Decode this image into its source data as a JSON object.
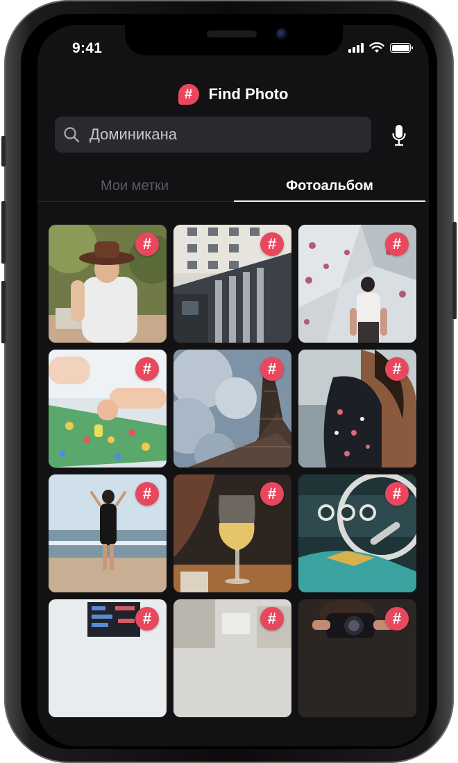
{
  "status_bar": {
    "time": "9:41",
    "icons": [
      "signal-icon",
      "wifi-icon",
      "battery-icon"
    ],
    "battery_level": 1.0
  },
  "header": {
    "logo_glyph": "#",
    "title": "Find Photo"
  },
  "search": {
    "value": "Доминикана",
    "icon": "search-icon",
    "mic_icon": "microphone-icon"
  },
  "tabs": [
    {
      "label": "Мои метки",
      "active": false
    },
    {
      "label": "Фотоальбом",
      "active": true
    }
  ],
  "photos": [
    {
      "subject": "man-in-hat",
      "badge": "#"
    },
    {
      "subject": "building",
      "badge": "#"
    },
    {
      "subject": "climbing-wall",
      "badge": "#"
    },
    {
      "subject": "board-game",
      "badge": "#"
    },
    {
      "subject": "eiffel-tower",
      "badge": "#"
    },
    {
      "subject": "woman-sea",
      "badge": "#"
    },
    {
      "subject": "woman-beach",
      "badge": "#"
    },
    {
      "subject": "wine-glass",
      "badge": "#"
    },
    {
      "subject": "car-dashboard",
      "badge": "#"
    },
    {
      "subject": "monitor",
      "badge": "#"
    },
    {
      "subject": "room",
      "badge": "#"
    },
    {
      "subject": "photographer",
      "badge": "#"
    }
  ],
  "colors": {
    "accent": "#e8485e",
    "background": "#121214",
    "search_bg": "#2a2a2e",
    "tab_inactive": "#5a5a60"
  }
}
